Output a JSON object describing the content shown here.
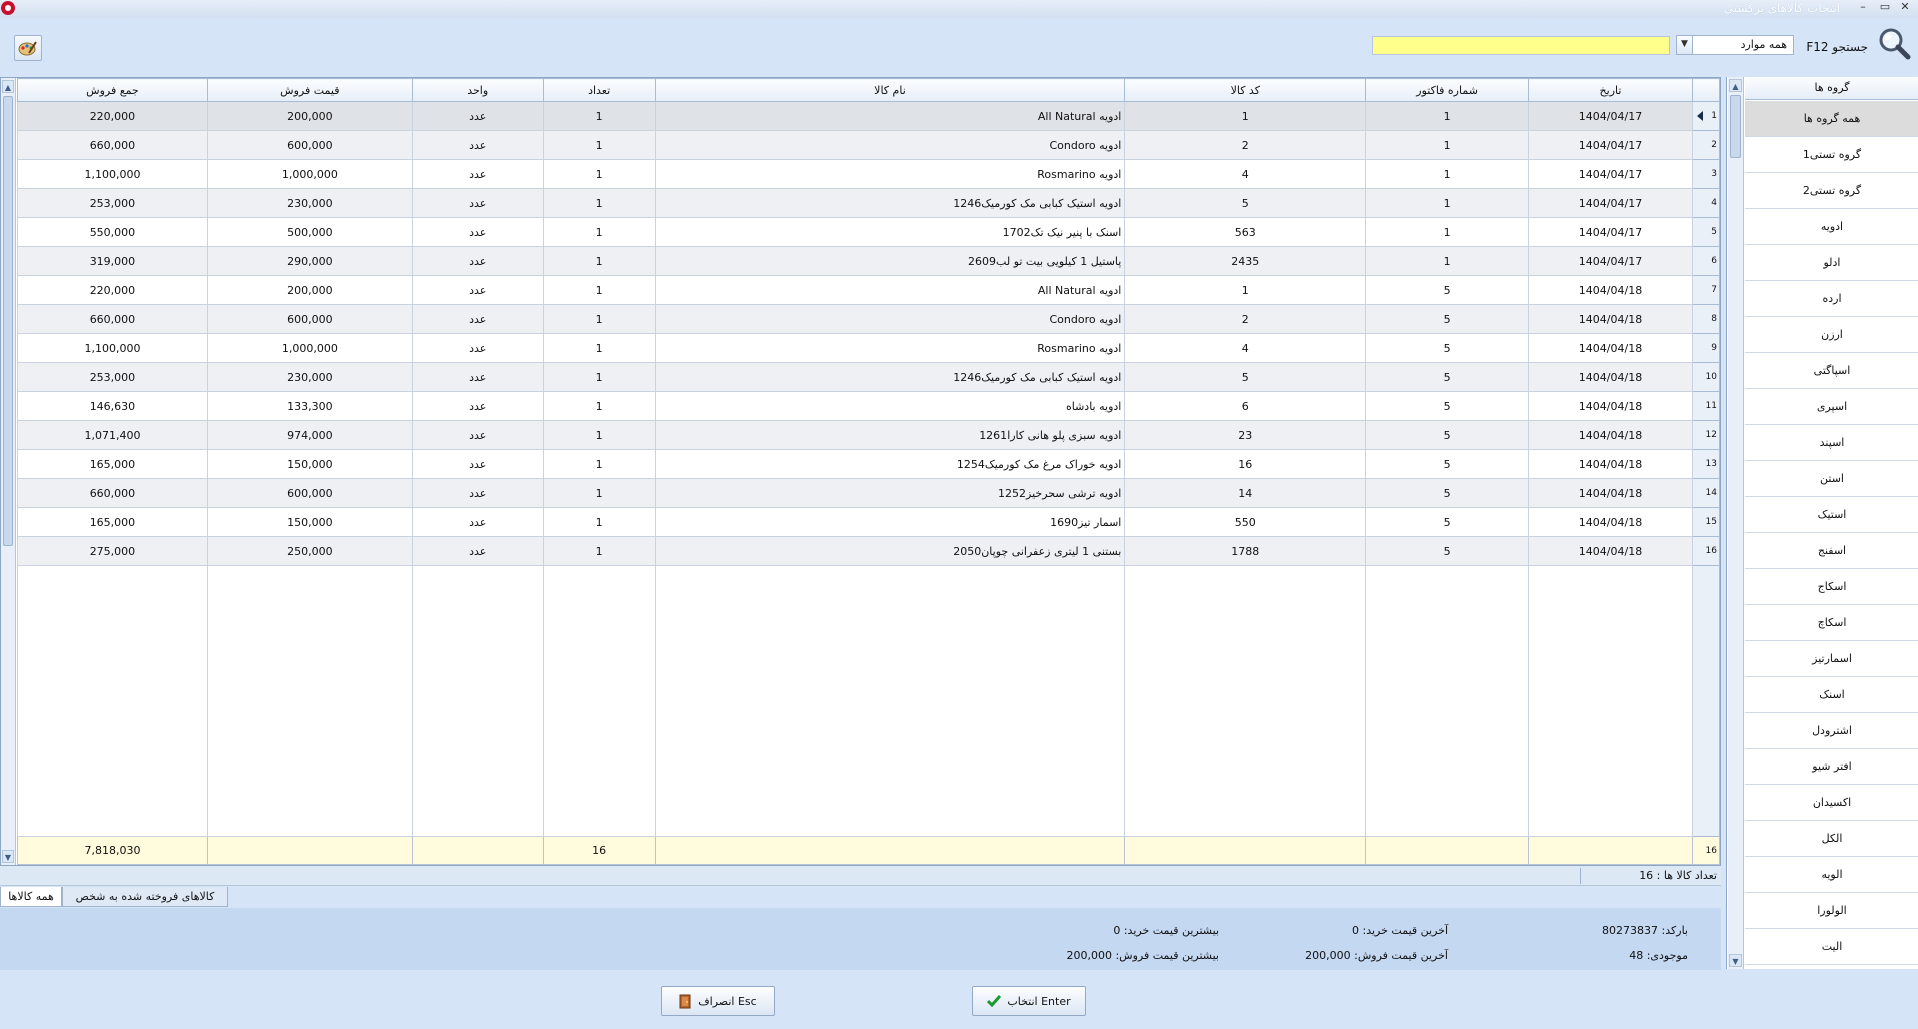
{
  "window": {
    "title": "انتخاب کالاهای برگشتی",
    "minimize": "–",
    "maximize": "▭",
    "close": "✕"
  },
  "toolbar": {
    "search_label": "جستجو F12",
    "filter_value": "همه موارد",
    "search_value": ""
  },
  "grid": {
    "columns": [
      "جمع فروش",
      "قیمت فروش",
      "واحد",
      "تعداد",
      "نام کالا",
      "کد کالا",
      "شماره فاکتور",
      "تاریخ"
    ],
    "rows": [
      {
        "total": "220,000",
        "price": "200,000",
        "unit": "عدد",
        "qty": "1",
        "name": "ادویه All Natural",
        "code": "1",
        "invoice": "1",
        "date": "1404/04/17",
        "row": "1"
      },
      {
        "total": "660,000",
        "price": "600,000",
        "unit": "عدد",
        "qty": "1",
        "name": "ادویه Condoro",
        "code": "2",
        "invoice": "1",
        "date": "1404/04/17",
        "row": "2"
      },
      {
        "total": "1,100,000",
        "price": "1,000,000",
        "unit": "عدد",
        "qty": "1",
        "name": "ادویه Rosmarino",
        "code": "4",
        "invoice": "1",
        "date": "1404/04/17",
        "row": "3"
      },
      {
        "total": "253,000",
        "price": "230,000",
        "unit": "عدد",
        "qty": "1",
        "name": "ادویه استیک کبابی مک کورمیک1246",
        "code": "5",
        "invoice": "1",
        "date": "1404/04/17",
        "row": "4"
      },
      {
        "total": "550,000",
        "price": "500,000",
        "unit": "عدد",
        "qty": "1",
        "name": "اسنک با پنیر نیک تک1702",
        "code": "563",
        "invoice": "1",
        "date": "1404/04/17",
        "row": "5"
      },
      {
        "total": "319,000",
        "price": "290,000",
        "unit": "عدد",
        "qty": "1",
        "name": "پاستیل 1 کیلویی بیت تو لب2609",
        "code": "2435",
        "invoice": "1",
        "date": "1404/04/17",
        "row": "6"
      },
      {
        "total": "220,000",
        "price": "200,000",
        "unit": "عدد",
        "qty": "1",
        "name": "ادویه All Natural",
        "code": "1",
        "invoice": "5",
        "date": "1404/04/18",
        "row": "7"
      },
      {
        "total": "660,000",
        "price": "600,000",
        "unit": "عدد",
        "qty": "1",
        "name": "ادویه Condoro",
        "code": "2",
        "invoice": "5",
        "date": "1404/04/18",
        "row": "8"
      },
      {
        "total": "1,100,000",
        "price": "1,000,000",
        "unit": "عدد",
        "qty": "1",
        "name": "ادویه Rosmarino",
        "code": "4",
        "invoice": "5",
        "date": "1404/04/18",
        "row": "9"
      },
      {
        "total": "253,000",
        "price": "230,000",
        "unit": "عدد",
        "qty": "1",
        "name": "ادویه استیک کبابی مک کورمیک1246",
        "code": "5",
        "invoice": "5",
        "date": "1404/04/18",
        "row": "10"
      },
      {
        "total": "146,630",
        "price": "133,300",
        "unit": "عدد",
        "qty": "1",
        "name": "ادویه بادشاه",
        "code": "6",
        "invoice": "5",
        "date": "1404/04/18",
        "row": "11"
      },
      {
        "total": "1,071,400",
        "price": "974,000",
        "unit": "عدد",
        "qty": "1",
        "name": "ادویه سبزی پلو هانی کارا1261",
        "code": "23",
        "invoice": "5",
        "date": "1404/04/18",
        "row": "12"
      },
      {
        "total": "165,000",
        "price": "150,000",
        "unit": "عدد",
        "qty": "1",
        "name": "ادویه خوراک مرغ مک کورمیک1254",
        "code": "16",
        "invoice": "5",
        "date": "1404/04/18",
        "row": "13"
      },
      {
        "total": "660,000",
        "price": "600,000",
        "unit": "عدد",
        "qty": "1",
        "name": "ادویه ترشی سحرخیز1252",
        "code": "14",
        "invoice": "5",
        "date": "1404/04/18",
        "row": "14"
      },
      {
        "total": "165,000",
        "price": "150,000",
        "unit": "عدد",
        "qty": "1",
        "name": "اسمار تیز1690",
        "code": "550",
        "invoice": "5",
        "date": "1404/04/18",
        "row": "15"
      },
      {
        "total": "275,000",
        "price": "250,000",
        "unit": "عدد",
        "qty": "1",
        "name": "بستنی 1 لیتری زعفرانی چوپان2050",
        "code": "1788",
        "invoice": "5",
        "date": "1404/04/18",
        "row": "16"
      }
    ],
    "footer": {
      "total": "7,818,030",
      "qty": "16",
      "row": "16"
    }
  },
  "status": {
    "item_count": "تعداد کالا ها : 16"
  },
  "tabs": {
    "all_items": "همه کالاها",
    "sold_to_person": "کالاهای فروخته شده به شخص"
  },
  "info": {
    "barcode": "بارکد: 80273837",
    "stock": "موجودی: 48",
    "last_buy": "آخرین قیمت خرید: 0",
    "last_sell": "آخرین قیمت فروش: 200,000",
    "max_buy": "بیشترین قیمت خرید: 0",
    "max_sell": "بیشترین قیمت فروش: 200,000"
  },
  "buttons": {
    "select": "انتخاب Enter",
    "cancel": "انصراف Esc"
  },
  "groups": {
    "header": "گروه ها",
    "items": [
      "همه گروه ها",
      "گروه تستی1",
      "گروه تستی2",
      "ادویه",
      "ادلو",
      "ارده",
      "ارزن",
      "اسپاگتی",
      "اسپری",
      "اسپند",
      "استن",
      "استیک",
      "اسفنج",
      "اسکاج",
      "اسکاچ",
      "اسمارتیز",
      "اسنک",
      "اشترودل",
      "افتر شیو",
      "اکسیدان",
      "الکل",
      "الویه",
      "الولورا",
      "الیت"
    ]
  },
  "colors": {
    "background": "#d6e4f7",
    "search_field": "#ffff8c",
    "footer_row": "#fffbdc",
    "info_panel": "#c4d8f2"
  }
}
